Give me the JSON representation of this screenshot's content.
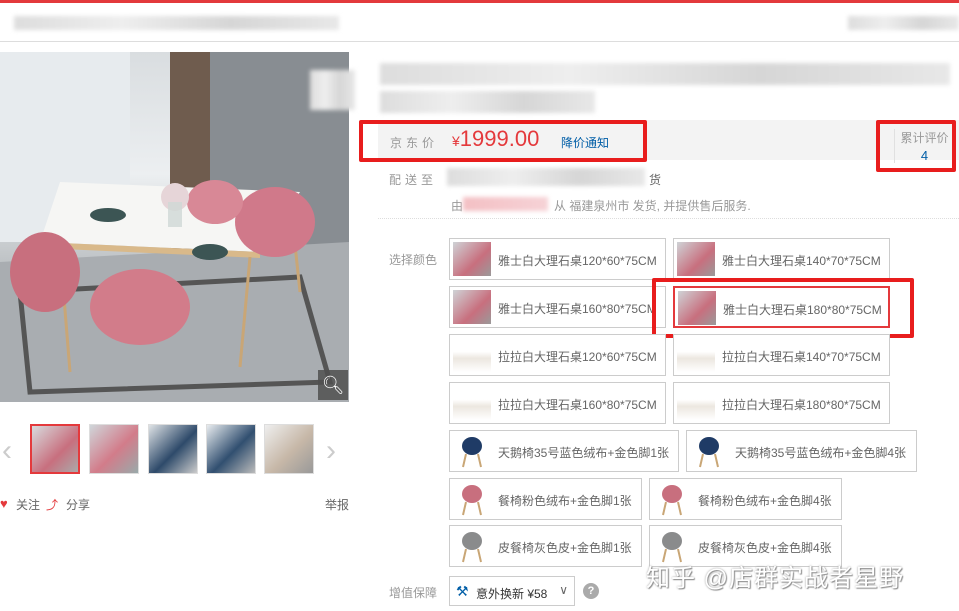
{
  "price": {
    "label": "京东价",
    "currency": "¥",
    "amount": "1999.00",
    "notify_link": "降价通知",
    "accent_color": "#e4393c"
  },
  "reviews": {
    "label": "累计评价",
    "count": "4"
  },
  "delivery": {
    "label": "配送至",
    "suffix": "货",
    "from_prefix": "由",
    "from_text": "从 福建泉州市 发货, 并提供售后服务."
  },
  "color_select": {
    "label": "选择颜色",
    "options": [
      {
        "label": "雅士白大理石桌120*60*75CM",
        "thumb": "dining-set-photo"
      },
      {
        "label": "雅士白大理石桌140*70*75CM",
        "thumb": "dining-set-photo"
      },
      {
        "label": "雅士白大理石桌160*80*75CM",
        "thumb": "dining-set-photo"
      },
      {
        "label": "雅士白大理石桌180*80*75CM",
        "thumb": "dining-set-photo",
        "selected": true
      },
      {
        "label": "拉拉白大理石桌120*60*75CM",
        "thumb": "white-table-photo"
      },
      {
        "label": "拉拉白大理石桌140*70*75CM",
        "thumb": "white-table-photo"
      },
      {
        "label": "拉拉白大理石桌160*80*75CM",
        "thumb": "white-table-photo"
      },
      {
        "label": "拉拉白大理石桌180*80*75CM",
        "thumb": "white-table-photo"
      },
      {
        "label": "天鹅椅35号蓝色绒布+金色脚1张",
        "thumb": "blue-chair-photo"
      },
      {
        "label": "天鹅椅35号蓝色绒布+金色脚4张",
        "thumb": "blue-chair-photo"
      },
      {
        "label": "餐椅粉色绒布+金色脚1张",
        "thumb": "pink-chair-photo"
      },
      {
        "label": "餐椅粉色绒布+金色脚4张",
        "thumb": "pink-chair-photo"
      },
      {
        "label": "皮餐椅灰色皮+金色脚1张",
        "thumb": "gray-chair-photo"
      },
      {
        "label": "皮餐椅灰色皮+金色脚4张",
        "thumb": "gray-chair-photo"
      }
    ]
  },
  "value_added": {
    "label": "增值保障",
    "service": "意外换新 ¥58"
  },
  "gallery_actions": {
    "follow": "关注",
    "share": "分享",
    "report": "举报"
  },
  "watermark": "知乎 @店群实战者星野",
  "colors": {
    "link_blue": "#005ea7",
    "highlight_red": "#e81d1d"
  }
}
